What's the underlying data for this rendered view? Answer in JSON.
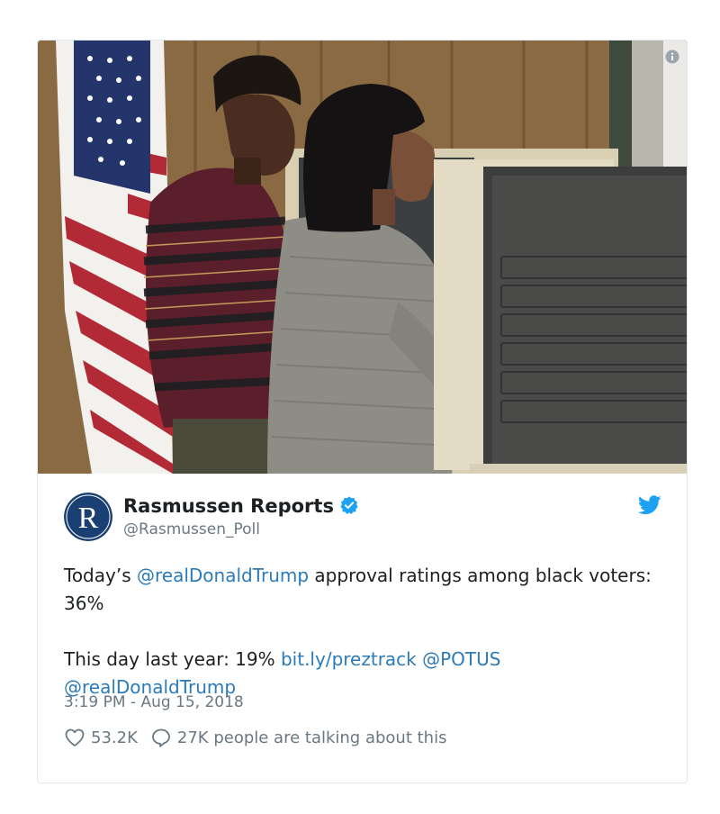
{
  "tweet": {
    "author_name": "Rasmussen Reports",
    "handle": "@Rasmussen_Poll",
    "avatar_letter": "R",
    "text_p1_a": "Today’s ",
    "mention_1": "@realDonaldTrump",
    "text_p1_b": " approval ratings among black voters: 36%",
    "text_p2_a": "This day last year: 19% ",
    "link_1": "bit.ly/preztrack",
    "mention_2": "@POTUS",
    "mention_3": "@realDonaldTrump",
    "timestamp": "3:19 PM - Aug 15, 2018",
    "likes": "53.2K",
    "talking": "27K people are talking about this"
  },
  "colors": {
    "link": "#2b7bb9",
    "verified": "#1da1f2",
    "avatar_bg": "#1a3f73",
    "muted": "#697882"
  },
  "icons": [
    "info-icon",
    "verified-badge-icon",
    "twitter-bird-icon",
    "heart-icon",
    "reply-bubble-icon"
  ]
}
